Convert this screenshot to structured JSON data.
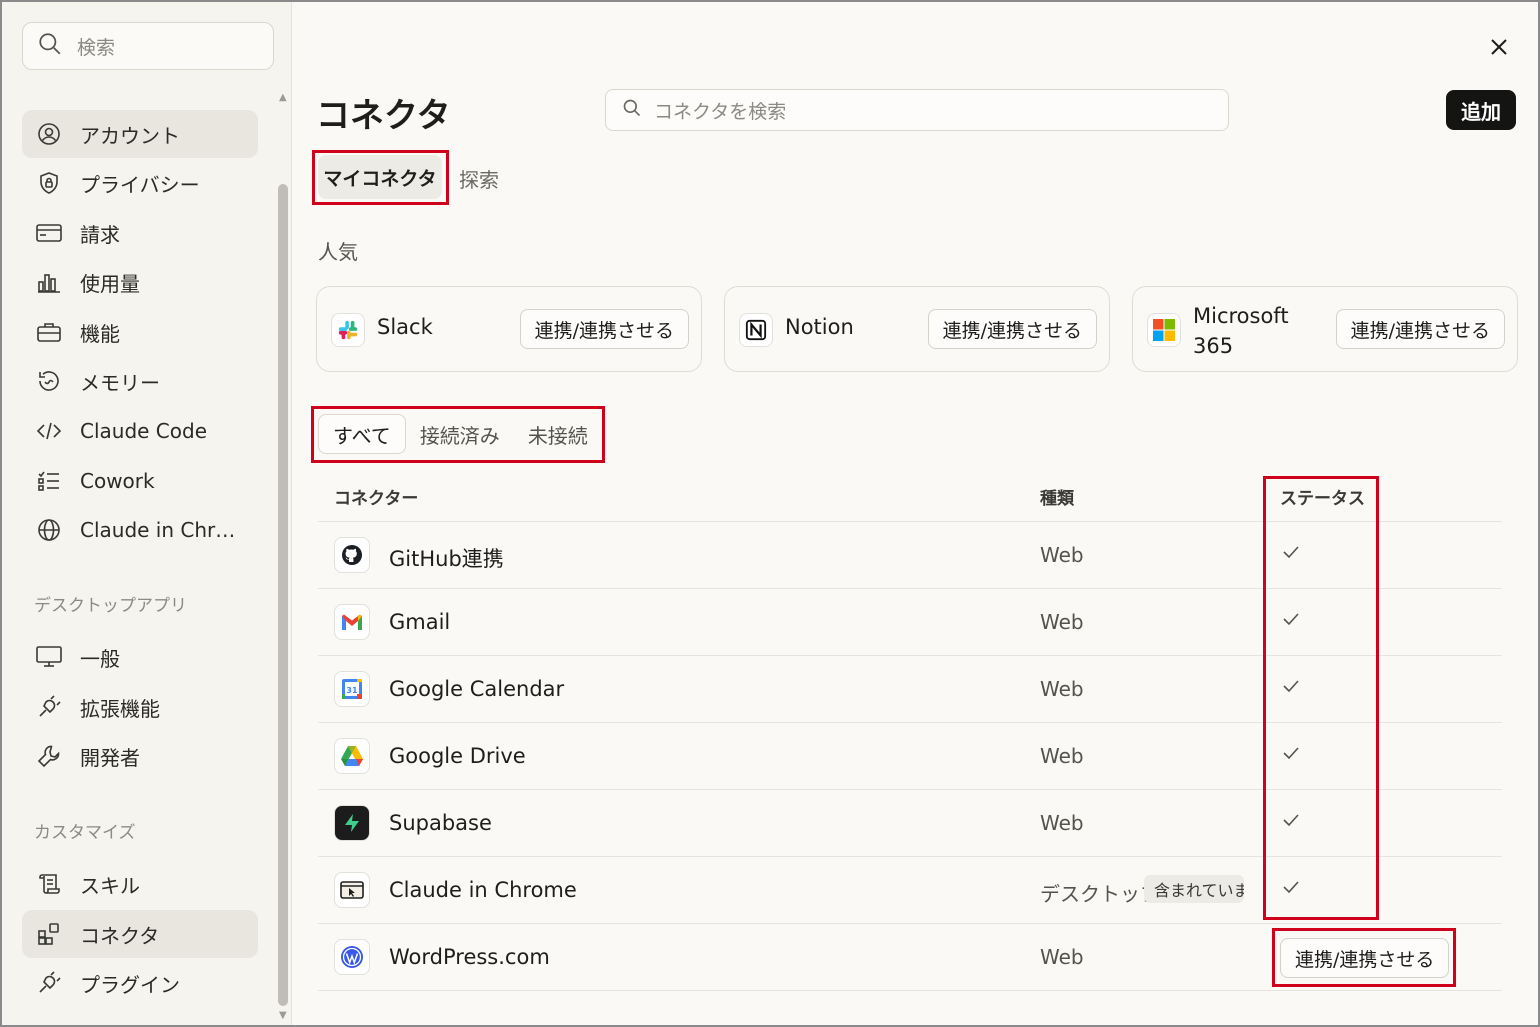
{
  "sidebar": {
    "search_placeholder": "検索",
    "items": [
      {
        "label": "アカウント",
        "icon": "account-circle-icon"
      },
      {
        "label": "プライバシー",
        "icon": "shield-lock-icon"
      },
      {
        "label": "請求",
        "icon": "credit-card-icon"
      },
      {
        "label": "使用量",
        "icon": "bar-chart-icon"
      },
      {
        "label": "機能",
        "icon": "briefcase-icon"
      },
      {
        "label": "メモリー",
        "icon": "history-icon"
      },
      {
        "label": "Claude Code",
        "icon": "code-icon"
      },
      {
        "label": "Cowork",
        "icon": "checklist-icon"
      },
      {
        "label": "Claude in Chr…",
        "icon": "globe-icon"
      }
    ],
    "section_desktop": "デスクトップアプリ",
    "desktop_items": [
      {
        "label": "一般",
        "icon": "monitor-icon"
      },
      {
        "label": "拡張機能",
        "icon": "plug-icon"
      },
      {
        "label": "開発者",
        "icon": "wrench-icon"
      }
    ],
    "section_customize": "カスタマイズ",
    "customize_items": [
      {
        "label": "スキル",
        "icon": "scroll-icon"
      },
      {
        "label": "コネクタ",
        "icon": "grid-plus-icon"
      },
      {
        "label": "プラグイン",
        "icon": "plug-icon"
      }
    ]
  },
  "main": {
    "title": "コネクタ",
    "search_placeholder": "コネクタを検索",
    "add_label": "追加",
    "tabs": [
      "マイコネクタ",
      "探索"
    ],
    "popular_label": "人気",
    "popular": [
      {
        "name": "Slack",
        "button": "連携/連携させる"
      },
      {
        "name": "Notion",
        "button": "連携/連携させる"
      },
      {
        "name": "Microsoft 365",
        "button": "連携/連携させる"
      }
    ],
    "filters": [
      "すべて",
      "接続済み",
      "未接続"
    ],
    "table": {
      "headers": [
        "コネクター",
        "種類",
        "ステータス"
      ],
      "rows": [
        {
          "name": "GitHub連携",
          "type": "Web",
          "status": "connected"
        },
        {
          "name": "Gmail",
          "type": "Web",
          "status": "connected"
        },
        {
          "name": "Google Calendar",
          "type": "Web",
          "status": "connected"
        },
        {
          "name": "Google Drive",
          "type": "Web",
          "status": "connected"
        },
        {
          "name": "Supabase",
          "type": "Web",
          "status": "connected"
        },
        {
          "name": "Claude in Chrome",
          "type": "デスクトップ",
          "badge": "含まれています",
          "status": "connected"
        },
        {
          "name": "WordPress.com",
          "type": "Web",
          "status": "not-connected",
          "button": "連携/連携させる"
        }
      ]
    }
  },
  "colors": {
    "accent_dark": "#141413",
    "highlight_red": "#d0021b",
    "background": "#faf9f5"
  }
}
